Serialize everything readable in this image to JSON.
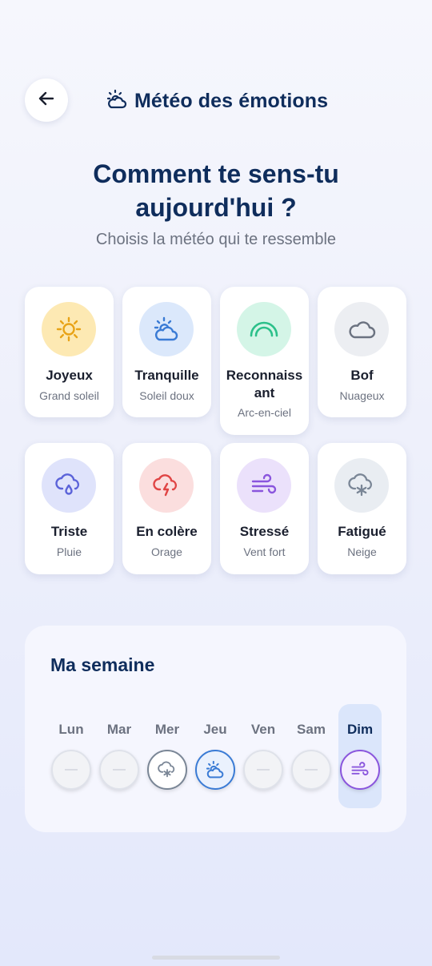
{
  "header": {
    "title": "Météo des émotions",
    "back_icon": "arrow-left-icon",
    "title_icon": "sun-behind-cloud-icon"
  },
  "headline": {
    "line1": "Comment te sens-tu",
    "line2": "aujourd'hui ?"
  },
  "subtitle": "Choisis la météo qui te ressemble",
  "emotions": [
    {
      "label": "Joyeux",
      "weather": "Grand soleil",
      "icon": "sun-icon",
      "color": "#e8a317",
      "bg": "#fde9b3"
    },
    {
      "label": "Tranquille",
      "weather": "Soleil doux",
      "icon": "sun-cloud-icon",
      "color": "#3a7bd5",
      "bg": "#dbe8fb"
    },
    {
      "label": "Reconnaissant",
      "label_line1": "Reconnaiss",
      "label_line2": "ant",
      "weather": "Arc-en-ciel",
      "icon": "rainbow-icon",
      "color": "#2cc08a",
      "bg": "#d4f5e7"
    },
    {
      "label": "Bof",
      "weather": "Nuageux",
      "icon": "cloud-icon",
      "color": "#6b7280",
      "bg": "#eceef2"
    },
    {
      "label": "Triste",
      "weather": "Pluie",
      "icon": "rain-cloud-icon",
      "color": "#5b63d9",
      "bg": "#dfe3fb"
    },
    {
      "label": "En colère",
      "weather": "Orage",
      "icon": "storm-cloud-icon",
      "color": "#e04545",
      "bg": "#fbdede"
    },
    {
      "label": "Stressé",
      "weather": "Vent fort",
      "icon": "wind-icon",
      "color": "#8a55dd",
      "bg": "#ebe1fb"
    },
    {
      "label": "Fatigué",
      "weather": "Neige",
      "icon": "snow-cloud-icon",
      "color": "#7a8696",
      "bg": "#e9edf2"
    }
  ],
  "week": {
    "title": "Ma semaine",
    "empty_mark": "—",
    "days": [
      {
        "label": "Lun",
        "state": "empty"
      },
      {
        "label": "Mar",
        "state": "empty"
      },
      {
        "label": "Mer",
        "state": "snow-cloud-icon",
        "color": "#7a8696"
      },
      {
        "label": "Jeu",
        "state": "sun-cloud-icon",
        "color": "#3a7bd5"
      },
      {
        "label": "Ven",
        "state": "empty"
      },
      {
        "label": "Sam",
        "state": "empty"
      },
      {
        "label": "Dim",
        "state": "wind-icon",
        "color": "#8a55dd",
        "current": true
      }
    ]
  }
}
